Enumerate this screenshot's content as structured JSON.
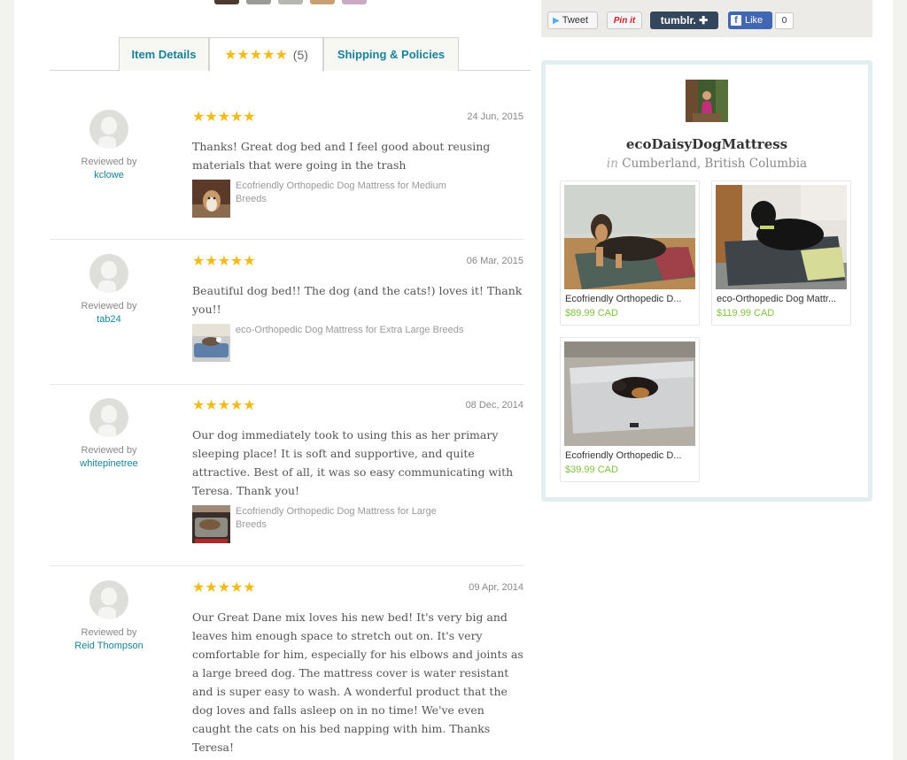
{
  "tabs": {
    "item_details": "Item Details",
    "reviews_count": "(5)",
    "reviews_stars": "★★★★★",
    "shipping": "Shipping & Policies"
  },
  "reviews": [
    {
      "stars": "★★★★★",
      "date": "24 Jun, 2015",
      "reviewed_by": "Reviewed by",
      "reviewer": "kclowe",
      "text": "Thanks! Great dog bed and I feel good about reusing materials that were going in the trash",
      "item_title": "Ecofriendly Orthopedic Dog Mattress for Medium Breeds"
    },
    {
      "stars": "★★★★★",
      "date": "06 Mar, 2015",
      "reviewed_by": "Reviewed by",
      "reviewer": "tab24",
      "text": "Beautiful dog bed!! The dog (and the cats!) loves it! Thank you!!",
      "item_title": "eco-Orthopedic Dog Mattress for Extra Large Breeds"
    },
    {
      "stars": "★★★★★",
      "date": "08 Dec, 2014",
      "reviewed_by": "Reviewed by",
      "reviewer": "whitepinetree",
      "text": "Our dog immediately took to using this as her primary sleeping place! It is soft and supportive, and quite attractive. Best of all, it was so easy communicating with Teresa. Thank you!",
      "item_title": "Ecofriendly Orthopedic Dog Mattress for Large Breeds"
    },
    {
      "stars": "★★★★★",
      "date": "09 Apr, 2014",
      "reviewed_by": "Reviewed by",
      "reviewer": "Reid Thompson",
      "text": "Our Great Dane mix loves his new bed! It's very big and leaves him enough space to stretch out on. It's very comfortable for him, especially for his elbows and joints as a large breed dog. The mattress cover is water resistant and is super easy to wash. A wonderful product that the dog loves and falls asleep on in no time! We've even caught the cats on his bed napping with him. Thanks Teresa!",
      "item_title": ""
    }
  ],
  "social": {
    "tweet": "Tweet",
    "pin": "Pin it",
    "tumblr": "tumblr. ✚",
    "like": "Like",
    "like_count": "0"
  },
  "shop": {
    "name": "ecoDaisyDogMattress",
    "location_prefix": "in",
    "location": "Cumberland, British Columbia",
    "listings": [
      {
        "title": "Ecofriendly Orthopedic D...",
        "price": "$89.99 CAD"
      },
      {
        "title": "eco-Orthopedic Dog Mattr...",
        "price": "$119.99 CAD"
      },
      {
        "title": "Ecofriendly Orthopedic D...",
        "price": "$39.99 CAD"
      }
    ]
  },
  "colors": {
    "link": "#18829b",
    "star": "#f2bb1b",
    "price": "#7fc241"
  }
}
